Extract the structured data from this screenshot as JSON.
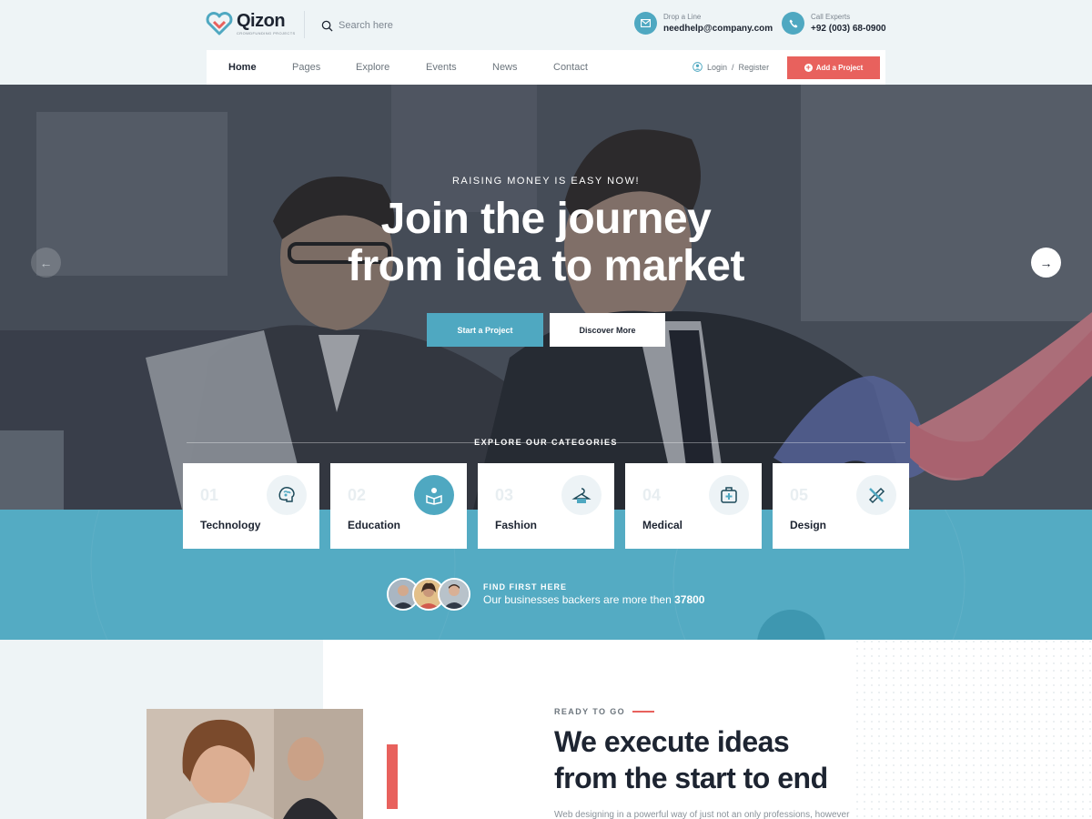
{
  "header": {
    "logo_name": "Qizon",
    "logo_tagline": "CROWDFUNDING PROJECTS",
    "search_placeholder": "Search here",
    "contacts": [
      {
        "label": "Drop a Line",
        "value": "needhelp@company.com",
        "icon": "mail-icon"
      },
      {
        "label": "Call Experts",
        "value": "+92 (003) 68-0900",
        "icon": "phone-icon"
      }
    ]
  },
  "nav": {
    "items": [
      {
        "label": "Home",
        "active": true
      },
      {
        "label": "Pages"
      },
      {
        "label": "Explore"
      },
      {
        "label": "Events"
      },
      {
        "label": "News"
      },
      {
        "label": "Contact"
      }
    ],
    "login_label": "Login",
    "separator": "/",
    "register_label": "Register",
    "add_project_label": "Add a Project"
  },
  "hero": {
    "subtitle": "RAISING MONEY IS EASY NOW!",
    "title_line1": "Join the journey",
    "title_line2": "from idea to market",
    "primary_button": "Start a Project",
    "secondary_button": "Discover More",
    "prev_arrow": "←",
    "next_arrow": "→",
    "explore_label": "EXPLORE OUR CATEGORIES"
  },
  "categories": [
    {
      "number": "01",
      "title": "Technology",
      "icon": "brain-icon"
    },
    {
      "number": "02",
      "title": "Education",
      "icon": "reading-icon",
      "active": true
    },
    {
      "number": "03",
      "title": "Fashion",
      "icon": "hanger-icon"
    },
    {
      "number": "04",
      "title": "Medical",
      "icon": "medical-kit-icon"
    },
    {
      "number": "05",
      "title": "Design",
      "icon": "ruler-pencil-icon"
    }
  ],
  "backers": {
    "label": "FIND FIRST HERE",
    "text": "Our businesses backers are more then",
    "count": "37800"
  },
  "about": {
    "eyebrow": "READY TO GO",
    "title_line1": "We execute ideas",
    "title_line2": "from the start to end",
    "paragraph": "Web designing in a powerful way of just not an only professions, however"
  },
  "colors": {
    "accent_teal": "#4fa8c1",
    "accent_red": "#e8615d",
    "dark_text": "#1d2431"
  }
}
